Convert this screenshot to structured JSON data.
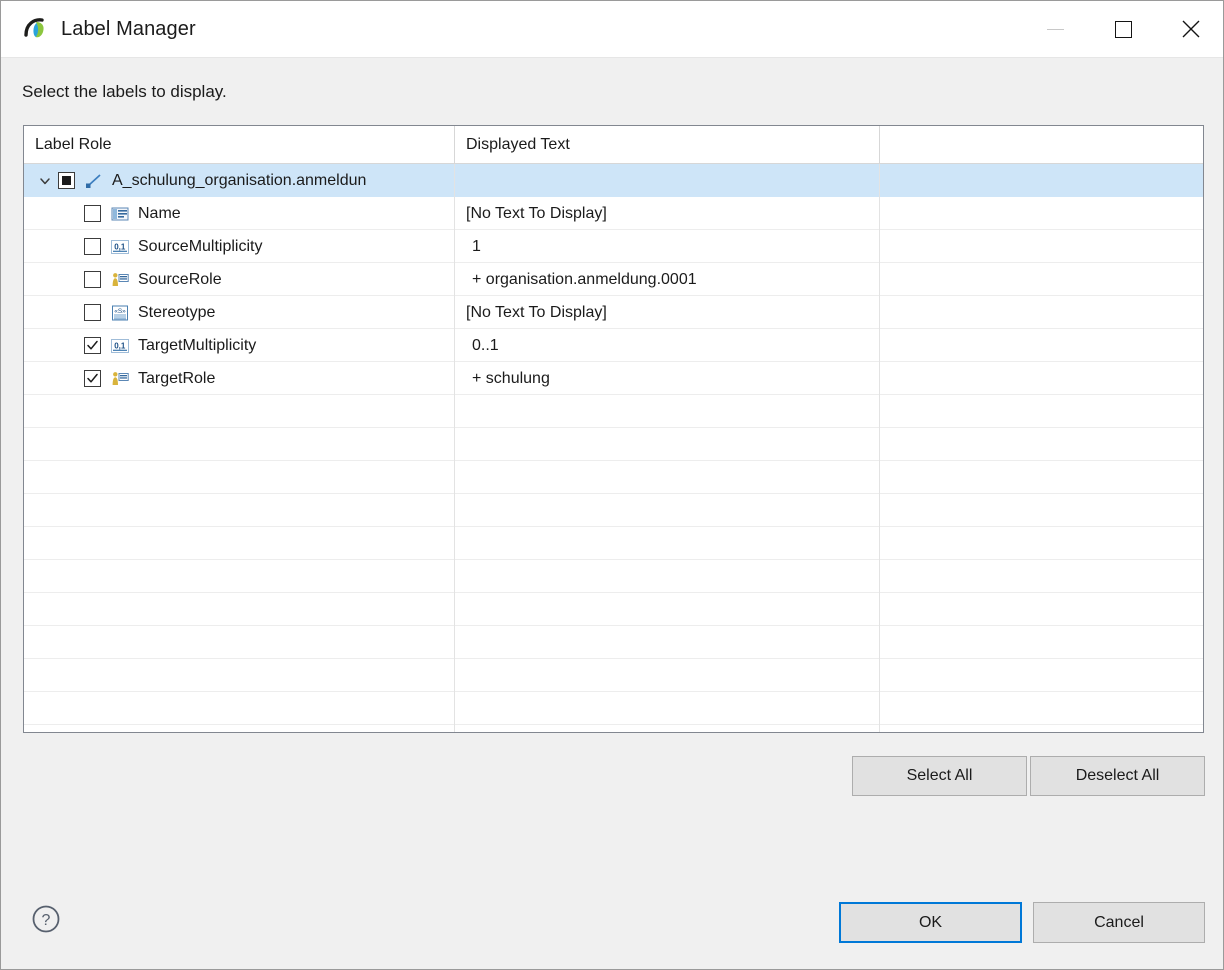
{
  "window": {
    "title": "Label Manager",
    "logo_icon": "app-logo-icon",
    "controls": {
      "minimize": "minimize-icon",
      "maximize": "maximize-icon",
      "close": "close-icon"
    }
  },
  "instruction": "Select the labels to display.",
  "table": {
    "columns": [
      "Label Role",
      "Displayed Text",
      ""
    ],
    "rows": [
      {
        "level": 0,
        "expanded": true,
        "twisty": "chevron-down-icon",
        "checkbox": "partial",
        "icon": "association-icon",
        "label": "A_schulung_organisation.anmeldun",
        "displayed_text": "",
        "selected": true
      },
      {
        "level": 1,
        "checkbox": "unchecked",
        "icon": "name-label-icon",
        "label": "Name",
        "displayed_text": "[No Text To Display]",
        "selected": false
      },
      {
        "level": 1,
        "checkbox": "unchecked",
        "icon": "multiplicity-icon",
        "label": "SourceMultiplicity",
        "displayed_text": "1",
        "indent_text": true,
        "selected": false
      },
      {
        "level": 1,
        "checkbox": "unchecked",
        "icon": "role-icon",
        "label": "SourceRole",
        "displayed_text": "+ organisation.anmeldung.0001",
        "indent_text": true,
        "selected": false
      },
      {
        "level": 1,
        "checkbox": "unchecked",
        "icon": "stereotype-icon",
        "label": "Stereotype",
        "displayed_text": "[No Text To Display]",
        "selected": false
      },
      {
        "level": 1,
        "checkbox": "checked",
        "icon": "multiplicity-icon",
        "label": "TargetMultiplicity",
        "displayed_text": "0..1",
        "indent_text": true,
        "selected": false
      },
      {
        "level": 1,
        "checkbox": "checked",
        "icon": "role-icon",
        "label": "TargetRole",
        "displayed_text": "+ schulung",
        "indent_text": true,
        "selected": false
      }
    ],
    "empty_row_count": 11
  },
  "buttons": {
    "select_all": "Select All",
    "deselect_all": "Deselect All",
    "ok": "OK",
    "cancel": "Cancel",
    "help_icon": "help-icon"
  },
  "colors": {
    "selection": "#cee5f8",
    "focus_border": "#0078d7",
    "dialog_bg": "#f0f0f0",
    "button_bg": "#e1e1e1",
    "text": "#1b1b1b"
  }
}
